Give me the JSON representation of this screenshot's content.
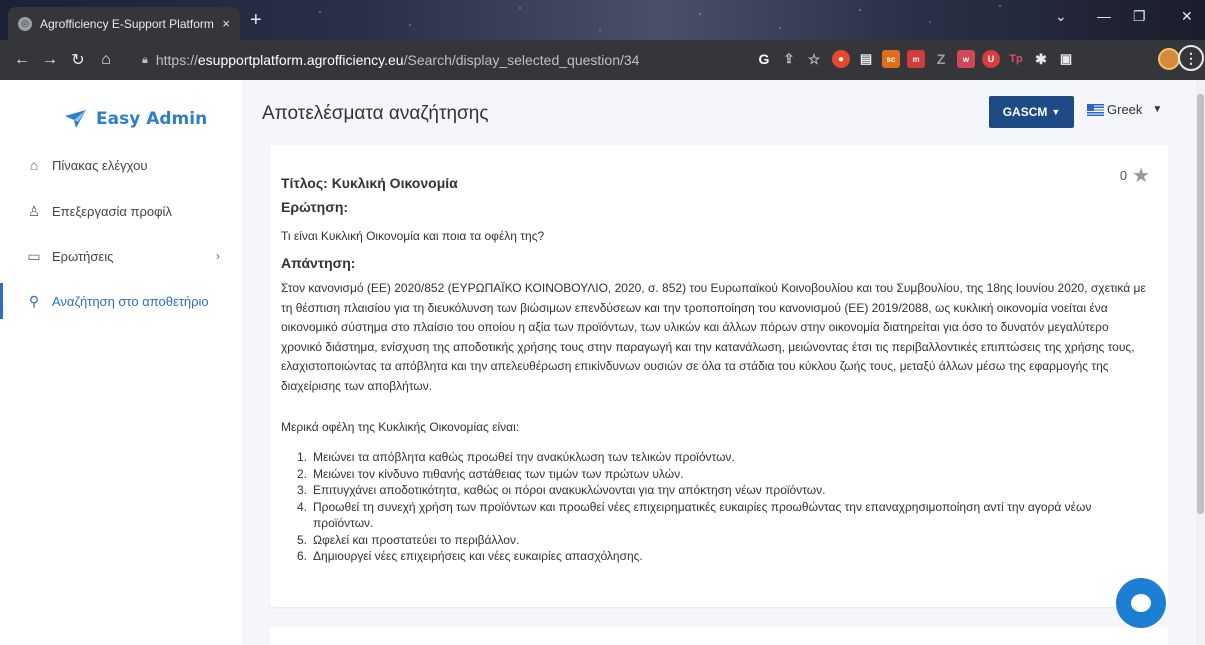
{
  "browser": {
    "tab_title": "Agrofficiency E-Support Platform",
    "tab_close": "×",
    "new_tab": "+",
    "url_prefix": "https://",
    "url_host": "esupportplatform.agrofficiency.eu",
    "url_path": "/Search/display_selected_question/34"
  },
  "sidebar": {
    "brand": "Easy Admin",
    "items": [
      {
        "label": "Πίνακας ελέγχου",
        "icon": "home-icon"
      },
      {
        "label": "Επεξεργασία προφίλ",
        "icon": "user-icon"
      },
      {
        "label": "Ερωτήσεις",
        "icon": "chat-icon"
      },
      {
        "label": "Αναζήτηση στο αποθετήριο",
        "icon": "search-icon"
      }
    ]
  },
  "header": {
    "title": "Αποτελέσματα αναζήτησης",
    "org_button": "GASCM",
    "language": "Greek"
  },
  "result": {
    "rating_count": "0",
    "title": "Τίτλος: Κυκλική Οικονομία",
    "question_heading": "Ερώτηση:",
    "question": "Τι είναι Κυκλική Οικονομία και ποια τα οφέλη της?",
    "answer_heading": "Απάντηση:",
    "answer": "Στον κανονισμό (ΕΕ) 2020/852 (ΕΥΡΩΠΑΪΚΟ ΚΟΙΝΟΒΟΥΛΙΟ, 2020, σ. 852) του Ευρωπαϊκού Κοινοβουλίου και του Συμβουλίου, της 18ης Ιουνίου 2020, σχετικά με τη θέσπιση πλαισίου για τη διευκόλυνση των βιώσιμων επενδύσεων και την τροποποίηση του κανονισμού (ΕΕ) 2019/2088, ως κυκλική οικονομία νοείται ένα οικονομικό σύστημα στο πλαίσιο του οποίου η αξία των προϊόντων, των υλικών και άλλων πόρων στην οικονομία διατηρείται για όσο το δυνατόν μεγαλύτερο χρονικό διάστημα, ενίσχυση της αποδοτικής χρήσης τους στην παραγωγή και την κατανάλωση, μειώνοντας έτσι τις περιβαλλοντικές επιπτώσεις της χρήσης τους, ελαχιστοποιώντας τα απόβλητα και την απελευθέρωση επικίνδυνων ουσιών σε όλα τα στάδια του κύκλου ζωής τους, μεταξύ άλλων μέσω της εφαρμογής της διαχείρισης των αποβλήτων.",
    "benefits_intro": "Μερικά οφέλη της Κυκλικής Οικονομίας είναι:",
    "benefits": [
      {
        "num": "1.",
        "text": "Μειώνει τα απόβλητα καθώς προωθεί την ανακύκλωση των τελικών προϊόντων."
      },
      {
        "num": "2.",
        "text": "Μειώνει τον κίνδυνο πιθανής αστάθειας των τιμών των πρώτων υλών."
      },
      {
        "num": "3.",
        "text": "Επιτυγχάνει αποδοτικότητα, καθώς οι πόροι ανακυκλώνονται για την απόκτηση νέων προϊόντων."
      },
      {
        "num": "4.",
        "text": "Προωθεί τη συνεχή χρήση των προϊόντων και προωθεί νέες επιχειρηματικές ευκαιρίες προωθώντας την επαναχρησιμοποίηση αντί την αγορά νέων προϊόντων."
      },
      {
        "num": "5.",
        "text": "Ωφελεί και προστατεύει το περιβάλλον."
      },
      {
        "num": "6.",
        "text": " Δημιουργεί νέες επιχειρήσεις και νέες ευκαιρίες απασχόλησης."
      }
    ]
  },
  "colors": {
    "brand": "#2f7ec9",
    "active_nav": "#2d6ec3",
    "org_button_bg": "#1e4b86",
    "chat_button": "#1d7fd3"
  }
}
